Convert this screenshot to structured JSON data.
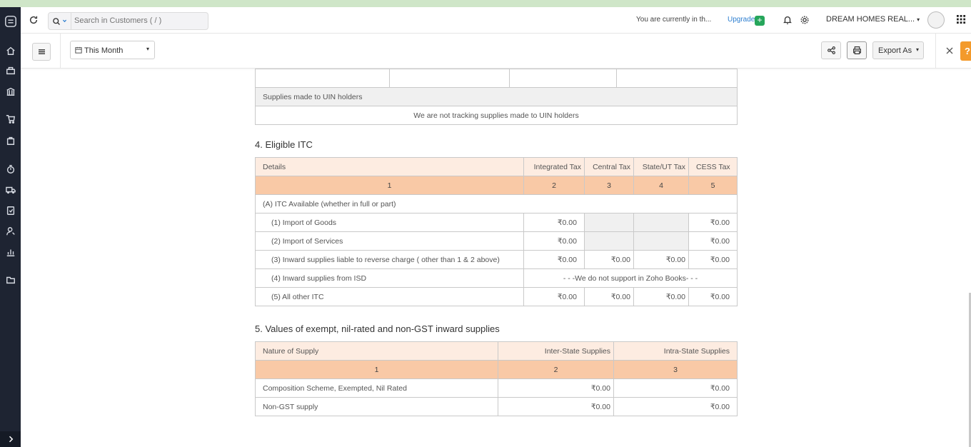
{
  "header": {
    "search_placeholder": "Search in Customers ( / )",
    "notice": "You are currently in th...",
    "upgrade": "Upgrade",
    "plus": "+",
    "org_name": "DREAM HOMES REAL..."
  },
  "toolbar": {
    "period": "This Month",
    "export": "Export As",
    "help": "?"
  },
  "top_table": {
    "uin_header": "Supplies made to UIN holders",
    "uin_note": "We are not tracking supplies made to UIN holders"
  },
  "itc": {
    "title": "4. Eligible ITC",
    "headers": [
      "Details",
      "Integrated Tax",
      "Central Tax",
      "State/UT Tax",
      "CESS Tax"
    ],
    "numbers": [
      "1",
      "2",
      "3",
      "4",
      "5"
    ],
    "section_a": "(A) ITC Available (whether in full or part)",
    "rows": [
      {
        "label": "(1) Import of Goods",
        "igst": "₹0.00",
        "cgst": "",
        "sgst": "",
        "cess": "₹0.00"
      },
      {
        "label": "(2) Import of Services",
        "igst": "₹0.00",
        "cgst": "",
        "sgst": "",
        "cess": "₹0.00"
      },
      {
        "label": "(3) Inward supplies liable to reverse charge ( other than 1 & 2 above)",
        "igst": "₹0.00",
        "cgst": "₹0.00",
        "sgst": "₹0.00",
        "cess": "₹0.00"
      },
      {
        "label": "(4) Inward supplies from ISD",
        "note": "- - -We do not support in Zoho Books- - -"
      },
      {
        "label": "(5) All other ITC",
        "igst": "₹0.00",
        "cgst": "₹0.00",
        "sgst": "₹0.00",
        "cess": "₹0.00"
      }
    ]
  },
  "exempt": {
    "title": "5. Values of exempt, nil-rated and non-GST inward supplies",
    "headers": [
      "Nature of Supply",
      "Inter-State Supplies",
      "Intra-State Supplies"
    ],
    "numbers": [
      "1",
      "2",
      "3"
    ],
    "rows": [
      {
        "label": "Composition Scheme, Exempted, Nil Rated",
        "inter": "₹0.00",
        "intra": "₹0.00"
      },
      {
        "label": "Non-GST supply",
        "inter": "₹0.00",
        "intra": "₹0.00"
      }
    ]
  },
  "colors": {
    "sidebar": "#1e2432",
    "header_row": "#fdece1",
    "number_row": "#f9c9a6",
    "accent": "#f39a2b",
    "link": "#2f80d1"
  }
}
